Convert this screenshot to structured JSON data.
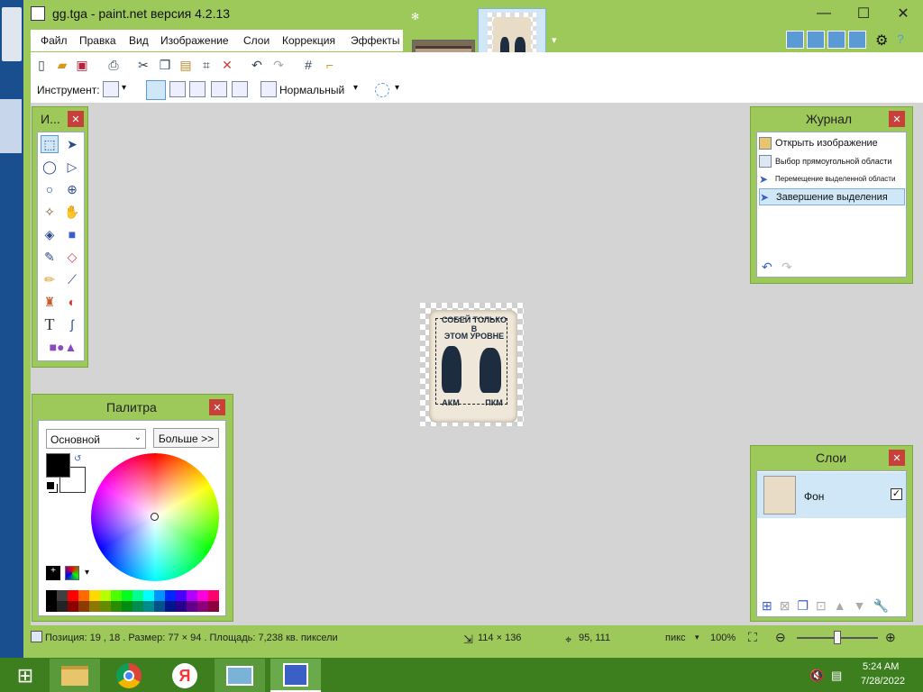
{
  "window": {
    "title": "gg.tga - paint.net версия 4.2.13"
  },
  "menu": [
    "Файл",
    "Правка",
    "Вид",
    "Изображение",
    "Слои",
    "Коррекция",
    "Эффекты"
  ],
  "toolbar": {
    "instrument_label": "Инструмент:",
    "blend_mode": "Нормальный"
  },
  "tools_panel": {
    "title": "И..."
  },
  "image_text": {
    "line1": "СОБЕЙ ТОЛЬКО",
    "line2": "В",
    "line3": "ЭТОМ УРОВНЕ",
    "bottom_left": "АКМ",
    "bottom_right": "ПКМ"
  },
  "history": {
    "title": "Журнал",
    "items": [
      "Открыть изображение",
      "Выбор прямоугольной области",
      "Перемещение выделенной области",
      "Завершение выделения"
    ]
  },
  "palette": {
    "title": "Палитра",
    "mode": "Основной",
    "more_button": "Больше >>"
  },
  "layers": {
    "title": "Слои",
    "items": [
      {
        "name": "Фон",
        "visible": true
      }
    ]
  },
  "status": {
    "info": "Позиция: 19 , 18 . Размер: 77  × 94 . Площадь: 7,238 кв. пиксели",
    "image_size": "114 × 136",
    "cursor": "95, 111",
    "unit": "пикс",
    "zoom": "100%"
  },
  "clock": {
    "time": "5:24 AM",
    "date": "7/28/2022"
  },
  "colors": {
    "accent": "#9dc95a",
    "close": "#c8403a",
    "taskbar": "#3d7f1e"
  },
  "palette_swatches": [
    "#000000",
    "#404040",
    "#ff0000",
    "#ff6a00",
    "#ffd800",
    "#b6ff00",
    "#4cff00",
    "#00ff21",
    "#00ff90",
    "#00ffff",
    "#0094ff",
    "#0026ff",
    "#4800ff",
    "#b200ff",
    "#ff00dc",
    "#ff006e"
  ]
}
